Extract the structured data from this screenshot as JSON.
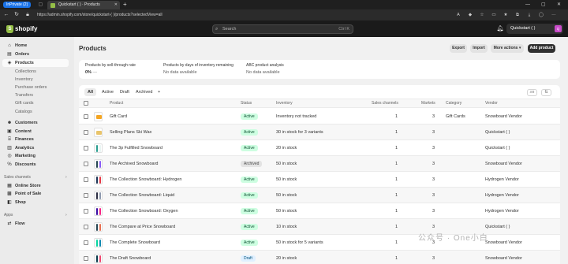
{
  "browser": {
    "inprivate_label": "InPrivate (2)",
    "tab_title": "Quickstart ( ) · Products",
    "url": "https://admin.shopify.com/store/quickstart-( )/products?selectedView=all"
  },
  "shop": {
    "logo_text": "shopify",
    "search_placeholder": "Search",
    "search_shortcut": "Ctrl K",
    "store_name": "Quickstart ( )",
    "avatar_initials": "Q"
  },
  "sidebar": {
    "items": [
      {
        "label": "Home",
        "icon": "home-icon"
      },
      {
        "label": "Orders",
        "icon": "orders-icon"
      },
      {
        "label": "Products",
        "icon": "tag-icon"
      }
    ],
    "product_sub": [
      "Collections",
      "Inventory",
      "Purchase orders",
      "Transfers",
      "Gift cards",
      "Catalogs"
    ],
    "items2": [
      {
        "label": "Customers",
        "icon": "person-icon"
      },
      {
        "label": "Content",
        "icon": "content-icon"
      },
      {
        "label": "Finances",
        "icon": "bank-icon"
      },
      {
        "label": "Analytics",
        "icon": "chart-icon"
      },
      {
        "label": "Marketing",
        "icon": "target-icon"
      },
      {
        "label": "Discounts",
        "icon": "discount-icon"
      }
    ],
    "sales_channels_heading": "Sales channels",
    "channels": [
      {
        "label": "Online Store",
        "icon": "store-icon"
      },
      {
        "label": "Point of Sale",
        "icon": "pos-icon"
      },
      {
        "label": "Shop",
        "icon": "shop-icon"
      }
    ],
    "apps_heading": "Apps",
    "apps": [
      {
        "label": "Flow",
        "icon": "flow-icon"
      }
    ]
  },
  "page": {
    "title": "Products",
    "export": "Export",
    "import": "Import",
    "more_actions": "More actions",
    "add_product": "Add product"
  },
  "stats": [
    {
      "label": "Products by sell-through rate",
      "value": "0%",
      "extra": "—"
    },
    {
      "label": "Products by days of inventory remaining",
      "value": "No data available"
    },
    {
      "label": "ABC product analysis",
      "value": "No data available"
    }
  ],
  "filters": [
    "All",
    "Active",
    "Draft",
    "Archived"
  ],
  "columns": [
    "Product",
    "Status",
    "Inventory",
    "Sales channels",
    "Markets",
    "Category",
    "Vendor"
  ],
  "products": [
    {
      "name": "Gift Card",
      "status": "Active",
      "inventory": "Inventory not tracked",
      "channels": "1",
      "markets": "3",
      "category": "Gift Cards",
      "vendor": "Snowboard Vendor"
    },
    {
      "name": "Selling Plans Ski Wax",
      "status": "Active",
      "inventory": "30 in stock for 3 variants",
      "channels": "1",
      "markets": "3",
      "category": "",
      "vendor": "Quickstart ( )"
    },
    {
      "name": "The 3p Fulfilled Snowboard",
      "status": "Active",
      "inventory": "20 in stock",
      "channels": "1",
      "markets": "3",
      "category": "",
      "vendor": "Quickstart ( )"
    },
    {
      "name": "The Archived Snowboard",
      "status": "Archived",
      "inventory": "50 in stock",
      "channels": "1",
      "markets": "3",
      "category": "",
      "vendor": "Snowboard Vendor"
    },
    {
      "name": "The Collection Snowboard: Hydrogen",
      "status": "Active",
      "inventory": "50 in stock",
      "channels": "1",
      "markets": "3",
      "category": "",
      "vendor": "Hydrogen Vendor"
    },
    {
      "name": "The Collection Snowboard: Liquid",
      "status": "Active",
      "inventory": "50 in stock",
      "channels": "1",
      "markets": "3",
      "category": "",
      "vendor": "Hydrogen Vendor"
    },
    {
      "name": "The Collection Snowboard: Oxygen",
      "status": "Active",
      "inventory": "50 in stock",
      "channels": "1",
      "markets": "3",
      "category": "",
      "vendor": "Hydrogen Vendor"
    },
    {
      "name": "The Compare at Price Snowboard",
      "status": "Active",
      "inventory": "10 in stock",
      "channels": "1",
      "markets": "3",
      "category": "",
      "vendor": "Quickstart ( )"
    },
    {
      "name": "The Complete Snowboard",
      "status": "Active",
      "inventory": "50 in stock for 5 variants",
      "channels": "1",
      "markets": "3",
      "category": "",
      "vendor": "Snowboard Vendor"
    },
    {
      "name": "The Draft Snowboard",
      "status": "Draft",
      "inventory": "20 in stock",
      "channels": "1",
      "markets": "3",
      "category": "",
      "vendor": "Snowboard Vendor"
    }
  ],
  "watermark": "公众号 · One小白"
}
